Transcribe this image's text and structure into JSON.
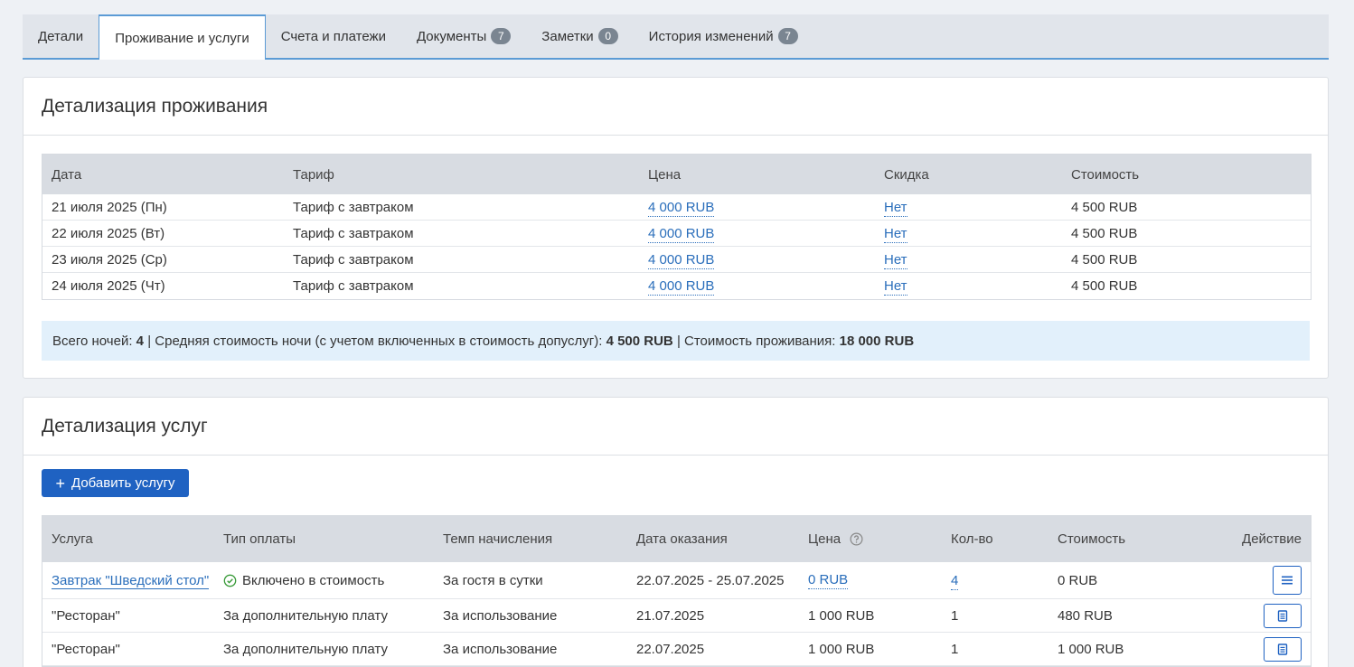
{
  "tabs": [
    {
      "label": "Детали"
    },
    {
      "label": "Проживание и услуги"
    },
    {
      "label": "Счета и платежи"
    },
    {
      "label": "Документы",
      "badge": "7"
    },
    {
      "label": "Заметки",
      "badge": "0"
    },
    {
      "label": "История изменений",
      "badge": "7"
    }
  ],
  "stay": {
    "title": "Детализация проживания",
    "headers": {
      "date": "Дата",
      "tariff": "Тариф",
      "price": "Цена",
      "discount": "Скидка",
      "cost": "Стоимость"
    },
    "rows": [
      {
        "date": "21 июля 2025 (Пн)",
        "tariff": "Тариф с завтраком",
        "price": "4 000 RUB",
        "discount": "Нет",
        "cost": "4 500 RUB"
      },
      {
        "date": "22 июля 2025 (Вт)",
        "tariff": "Тариф с завтраком",
        "price": "4 000 RUB",
        "discount": "Нет",
        "cost": "4 500 RUB"
      },
      {
        "date": "23 июля 2025 (Ср)",
        "tariff": "Тариф с завтраком",
        "price": "4 000 RUB",
        "discount": "Нет",
        "cost": "4 500 RUB"
      },
      {
        "date": "24 июля 2025 (Чт)",
        "tariff": "Тариф с завтраком",
        "price": "4 000 RUB",
        "discount": "Нет",
        "cost": "4 500 RUB"
      }
    ],
    "summary": {
      "nights_label": "Всего ночей:",
      "nights_value": "4",
      "avg_label": "Средняя стоимость ночи (с учетом включенных в стоимость допуслуг):",
      "avg_value": "4 500 RUB",
      "total_label": "Стоимость проживания:",
      "total_value": "18 000 RUB",
      "separator": "|"
    }
  },
  "services": {
    "title": "Детализация услуг",
    "add_button": "Добавить услугу",
    "headers": {
      "name": "Услуга",
      "pay": "Тип оплаты",
      "rate": "Темп начисления",
      "date": "Дата оказания",
      "price": "Цена",
      "qty": "Кол-во",
      "cost": "Стоимость",
      "action": "Действие"
    },
    "rows": [
      {
        "name": "Завтрак \"Шведский стол\"",
        "pay": "Включено в стоимость",
        "rate": "За гостя в сутки",
        "date": "22.07.2025 - 25.07.2025",
        "price": "0 RUB",
        "qty": "4",
        "cost": "0 RUB"
      },
      {
        "name": "\"Ресторан\"",
        "pay": "За дополнительную плату",
        "rate": "За использование",
        "date": "21.07.2025",
        "price": "1 000 RUB",
        "qty": "1",
        "cost": "480 RUB"
      },
      {
        "name": "\"Ресторан\"",
        "pay": "За дополнительную плату",
        "rate": "За использование",
        "date": "22.07.2025",
        "price": "1 000 RUB",
        "qty": "1",
        "cost": "1 000 RUB"
      }
    ]
  },
  "colors": {
    "accent": "#1f62c2",
    "link": "#2a6ebb",
    "summary_bg": "#e2f0fb",
    "table_head": "#d8dce2"
  }
}
